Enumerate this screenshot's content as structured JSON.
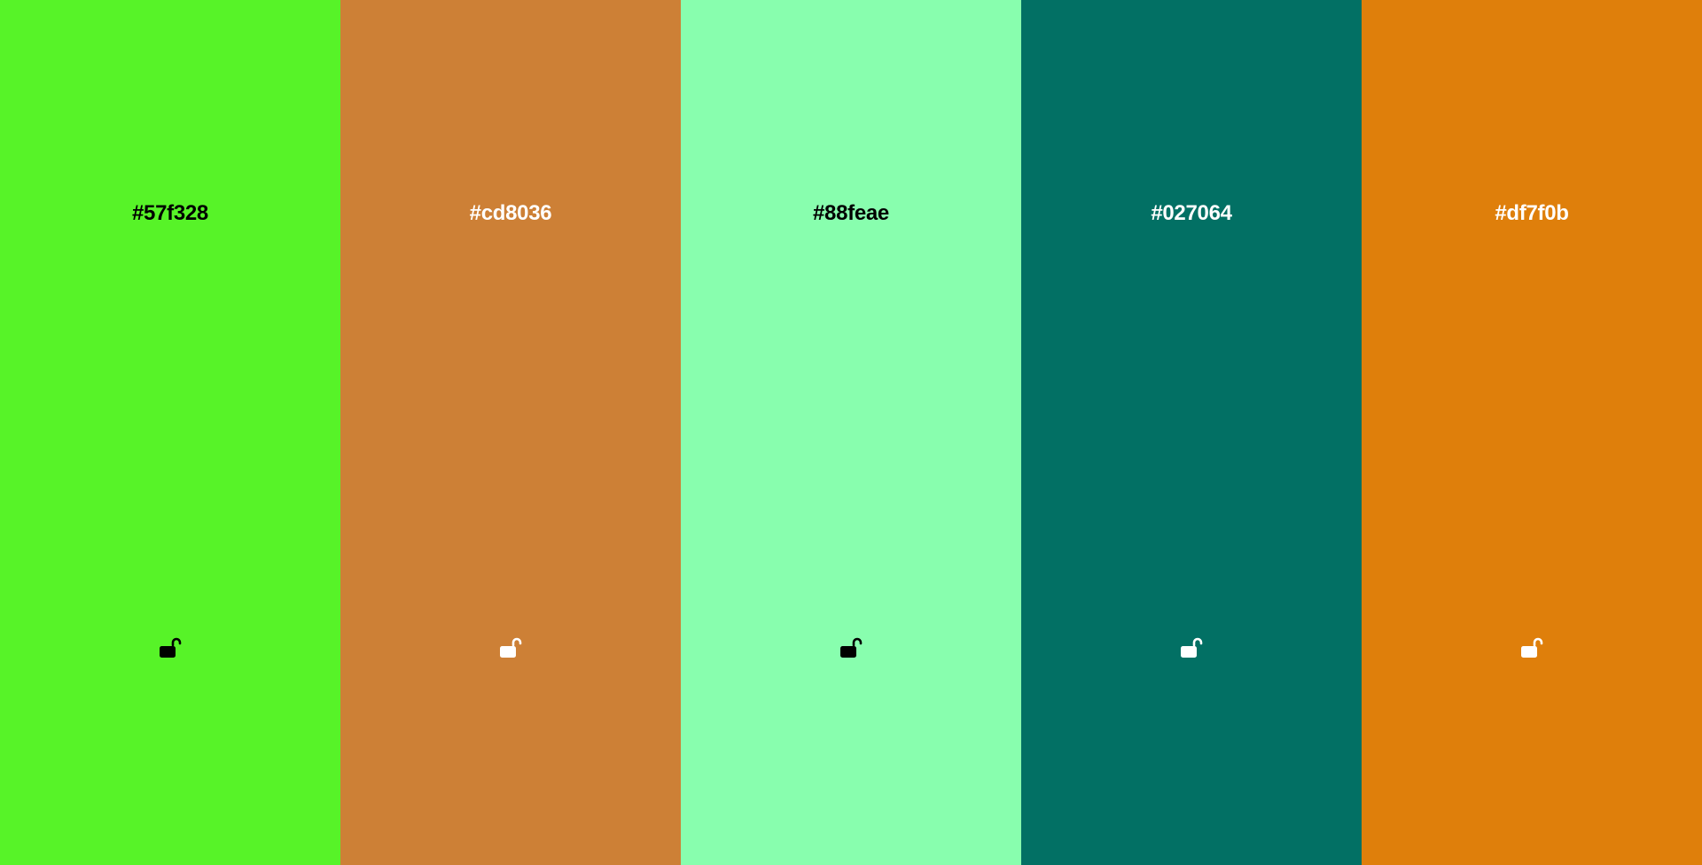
{
  "palette": {
    "swatches": [
      {
        "hex": "#57f328",
        "background": "#57f328",
        "text_color": "#000000",
        "lock_icon": "unlocked-padlock-icon"
      },
      {
        "hex": "#cd8036",
        "background": "#cd8036",
        "text_color": "#ffffff",
        "lock_icon": "unlocked-padlock-icon"
      },
      {
        "hex": "#88feae",
        "background": "#88feae",
        "text_color": "#000000",
        "lock_icon": "unlocked-padlock-icon"
      },
      {
        "hex": "#027064",
        "background": "#027064",
        "text_color": "#ffffff",
        "lock_icon": "unlocked-padlock-icon"
      },
      {
        "hex": "#df7f0b",
        "background": "#df7f0b",
        "text_color": "#ffffff",
        "lock_icon": "unlocked-padlock-icon"
      }
    ]
  }
}
